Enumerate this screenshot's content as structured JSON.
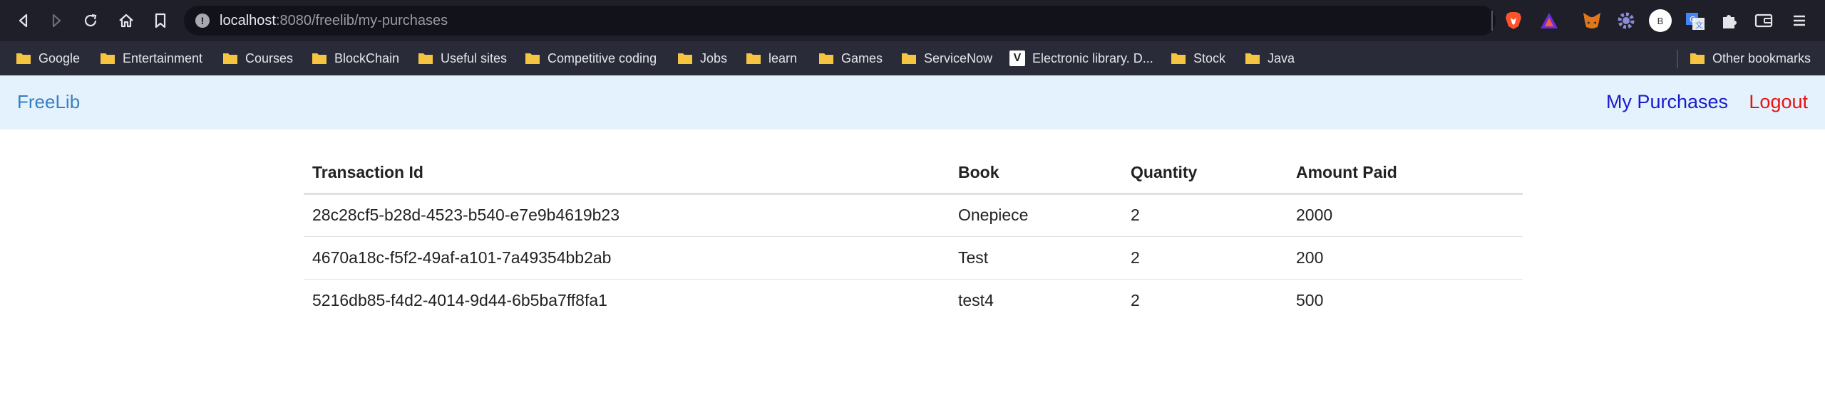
{
  "browser": {
    "url_host": "localhost",
    "url_rest": ":8080/freelib/my-purchases",
    "profile_initial": "B",
    "bookmarks": [
      {
        "label": "Google",
        "icon": "folder-icon"
      },
      {
        "label": "Entertainment",
        "icon": "folder-icon"
      },
      {
        "label": "Courses",
        "icon": "folder-icon"
      },
      {
        "label": "BlockChain",
        "icon": "folder-icon"
      },
      {
        "label": "Useful sites",
        "icon": "folder-icon"
      },
      {
        "label": "Competitive coding",
        "icon": "folder-icon"
      },
      {
        "label": "Jobs",
        "icon": "folder-icon"
      },
      {
        "label": "learn",
        "icon": "folder-icon"
      },
      {
        "label": "Games",
        "icon": "folder-icon"
      },
      {
        "label": "ServiceNow",
        "icon": "folder-icon"
      },
      {
        "label": "Electronic library. D...",
        "icon": "v-logo-icon"
      },
      {
        "label": "Stock",
        "icon": "folder-icon"
      },
      {
        "label": "Java",
        "icon": "folder-icon"
      }
    ],
    "other_bookmarks": "Other bookmarks",
    "colors": {
      "chrome_bg": "#1f1f29",
      "bookmarks_bg": "#2a2b38",
      "folder": "#f5c542"
    }
  },
  "navbar": {
    "brand": "FreeLib",
    "my_purchases": "My Purchases",
    "logout": "Logout",
    "colors": {
      "bg": "#e3f2fd",
      "brand": "#3a7fc0",
      "link": "#1a1acc",
      "logout": "#ee1111"
    }
  },
  "table": {
    "headers": [
      "Transaction Id",
      "Book",
      "Quantity",
      "Amount Paid"
    ],
    "rows": [
      [
        "28c28cf5-b28d-4523-b540-e7e9b4619b23",
        "Onepiece",
        "2",
        "2000"
      ],
      [
        "4670a18c-f5f2-49af-a101-7a49354bb2ab",
        "Test",
        "2",
        "200"
      ],
      [
        "5216db85-f4d2-4014-9d44-6b5ba7ff8fa1",
        "test4",
        "2",
        "500"
      ]
    ]
  }
}
